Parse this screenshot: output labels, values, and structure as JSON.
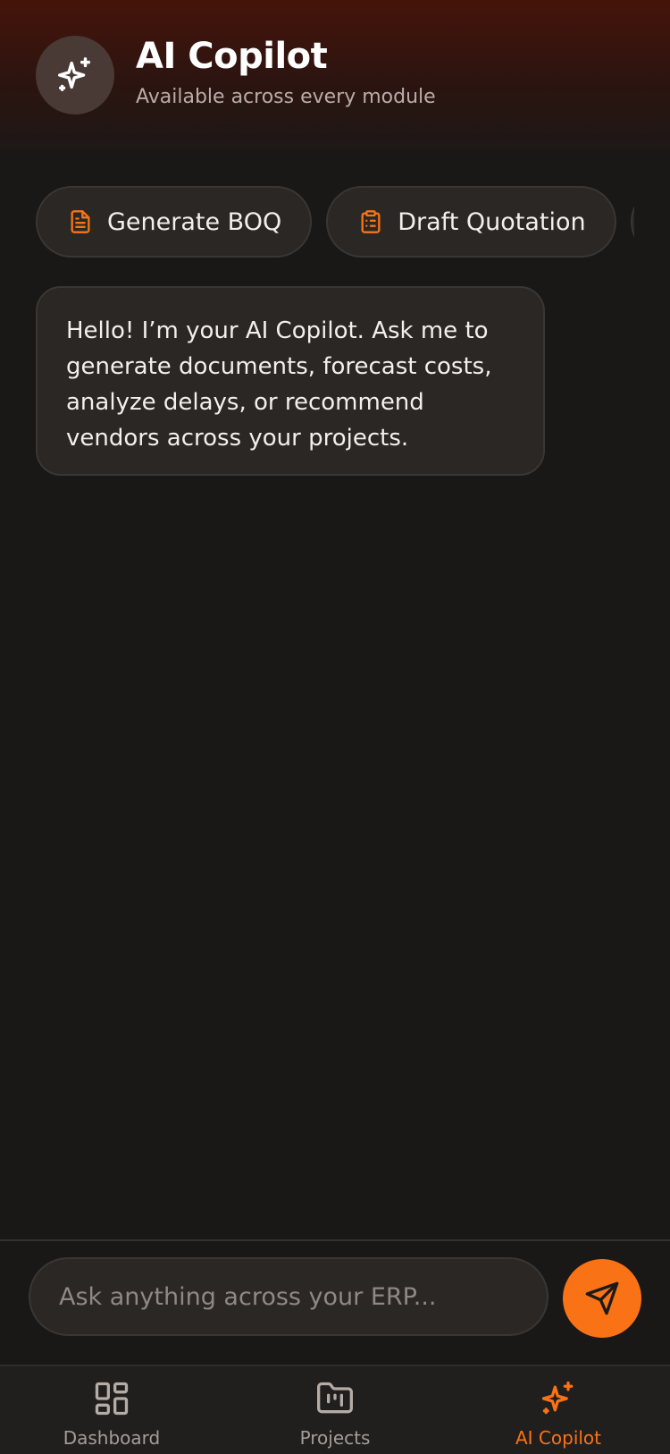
{
  "header": {
    "title": "AI Copilot",
    "subtitle": "Available across every module",
    "icon": "sparkles-icon"
  },
  "quick_actions": [
    {
      "label": "Generate BOQ",
      "icon": "file-text-icon"
    },
    {
      "label": "Draft Quotation",
      "icon": "clipboard-list-icon"
    }
  ],
  "messages": [
    {
      "role": "assistant",
      "text": "Hello! I’m your AI Copilot. Ask me to generate documents, forecast costs, analyze delays, or recommend vendors across your projects."
    }
  ],
  "composer": {
    "placeholder": "Ask anything across your ERP...",
    "value": "",
    "send_icon": "send-icon"
  },
  "nav": {
    "items": [
      {
        "label": "Dashboard",
        "icon": "layout-grid-icon"
      },
      {
        "label": "Projects",
        "icon": "folder-kanban-icon"
      },
      {
        "label": "AI Copilot",
        "icon": "sparkles-icon"
      }
    ],
    "active": "AI Copilot"
  },
  "colors": {
    "accent": "#f97316",
    "background": "#191817",
    "surface": "#2a2725",
    "header_gradient_top": "#45140b"
  }
}
